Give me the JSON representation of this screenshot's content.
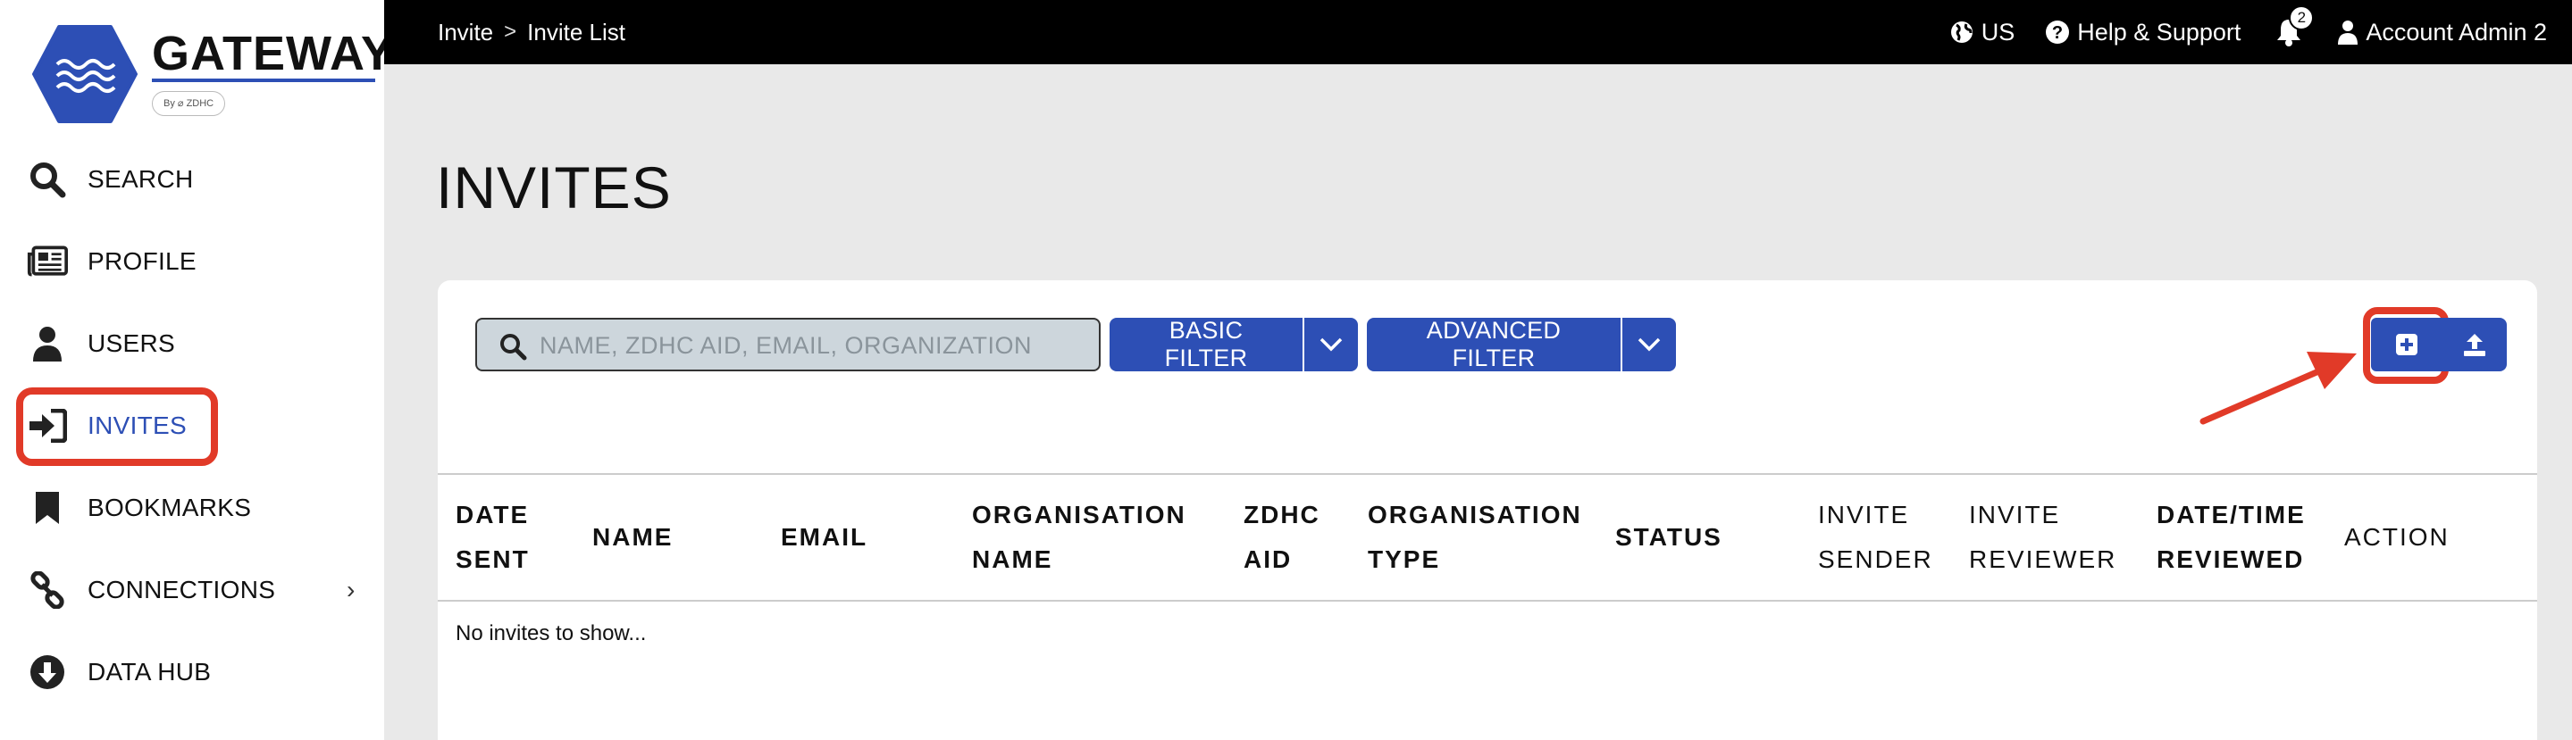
{
  "app": {
    "logo_word": "GATEWAY",
    "logo_byline": "By ⌀ ZDHC",
    "brand_color": "#2d4fb5",
    "highlight_color": "#e13a28"
  },
  "sidebar": {
    "items": [
      {
        "label": "SEARCH",
        "icon": "search-icon"
      },
      {
        "label": "PROFILE",
        "icon": "newspaper-icon"
      },
      {
        "label": "USERS",
        "icon": "user-icon"
      },
      {
        "label": "INVITES",
        "icon": "sign-in-icon",
        "active": true
      },
      {
        "label": "BOOKMARKS",
        "icon": "bookmark-icon"
      },
      {
        "label": "CONNECTIONS",
        "icon": "link-icon",
        "has_submenu": true
      },
      {
        "label": "DATA HUB",
        "icon": "download-circle-icon"
      }
    ]
  },
  "topbar": {
    "breadcrumb": [
      "Invite",
      "Invite List"
    ],
    "breadcrumb_separator": ">",
    "region": "US",
    "help": "Help & Support",
    "notification_count": "2",
    "account": "Account Admin 2"
  },
  "page": {
    "title": "INVITES"
  },
  "toolbar": {
    "search_placeholder": "NAME, ZDHC AID, EMAIL, ORGANIZATION",
    "basic_filter": "BASIC FILTER",
    "advanced_filter": "ADVANCED FILTER"
  },
  "table": {
    "columns": [
      {
        "line1": "DATE",
        "line2": "SENT",
        "bold": true
      },
      {
        "line1": "NAME",
        "line2": "",
        "bold": true
      },
      {
        "line1": "EMAIL",
        "line2": "",
        "bold": true
      },
      {
        "line1": "ORGANISATION",
        "line2": "NAME",
        "bold": true
      },
      {
        "line1": "ZDHC",
        "line2": "AID",
        "bold": true
      },
      {
        "line1": "ORGANISATION",
        "line2": "TYPE",
        "bold": true
      },
      {
        "line1": "STATUS",
        "line2": "",
        "bold": true
      },
      {
        "line1": "INVITE",
        "line2": "SENDER",
        "bold": false
      },
      {
        "line1": "INVITE",
        "line2": "REVIEWER",
        "bold": false
      },
      {
        "line1": "DATE/TIME",
        "line2": "REVIEWED",
        "bold": true
      },
      {
        "line1": "ACTION",
        "line2": "",
        "bold": false
      }
    ],
    "empty_message": "No invites to show..."
  }
}
